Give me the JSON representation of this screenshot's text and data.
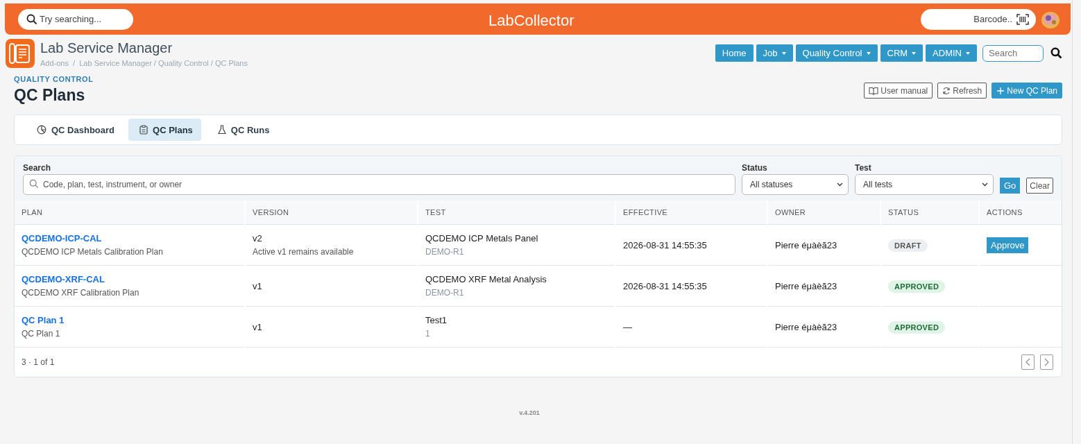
{
  "topbar": {
    "search_placeholder": "Try searching...",
    "logo": "LabCollector",
    "barcode_placeholder": "Barcode.."
  },
  "header": {
    "title": "Lab Service Manager",
    "breadcrumb": "Add-ons  /  Lab Service Manager / Quality Control / QC Plans"
  },
  "nav": [
    {
      "label": "Home",
      "dropdown": false
    },
    {
      "label": "Job",
      "dropdown": true
    },
    {
      "label": "Quality Control",
      "dropdown": true
    },
    {
      "label": "CRM",
      "dropdown": true
    },
    {
      "label": "ADMIN",
      "dropdown": true
    }
  ],
  "nav_search": {
    "placeholder": "Search"
  },
  "page": {
    "eyebrow": "QUALITY CONTROL",
    "title": "QC Plans",
    "actions": [
      {
        "label": "User manual",
        "kind": "manual"
      },
      {
        "label": "Refresh",
        "kind": "refresh"
      },
      {
        "label": "New QC Plan",
        "kind": "new"
      }
    ]
  },
  "tabs": [
    {
      "label": "QC Dashboard",
      "selected": false
    },
    {
      "label": "QC Plans",
      "selected": true
    },
    {
      "label": "QC Runs",
      "selected": false
    }
  ],
  "filters": {
    "search_label": "Search",
    "search_placeholder": "Code, plan, test, instrument, or owner",
    "status_label": "Status",
    "status_value": "All statuses",
    "test_label": "Test",
    "test_value": "All tests",
    "go": "Go",
    "clear": "Clear"
  },
  "table": {
    "columns": [
      "PLAN",
      "VERSION",
      "TEST",
      "EFFECTIVE",
      "OWNER",
      "STATUS",
      "ACTIONS"
    ],
    "rows": [
      {
        "code": "QCDEMO-ICP-CAL",
        "name": "QCDEMO ICP Metals Calibration Plan",
        "version": "v2",
        "version_note": "Active v1 remains available",
        "test": "QCDEMO ICP Metals Panel",
        "test_code": "DEMO-R1",
        "effective": "2026-08-31 14:55:35",
        "owner": "Pierre éμàèã23",
        "status": {
          "text": "DRAFT",
          "kind": "draft"
        },
        "action": "Approve"
      },
      {
        "code": "QCDEMO-XRF-CAL",
        "name": "QCDEMO XRF Calibration Plan",
        "version": "v1",
        "test": "QCDEMO XRF Metal Analysis",
        "test_code": "DEMO-R1",
        "effective": "2026-08-31 14:55:35",
        "owner": "Pierre éμàèã23",
        "status": {
          "text": "APPROVED",
          "kind": "approved"
        }
      },
      {
        "code": "QC Plan 1",
        "name": "QC Plan 1",
        "version": "v1",
        "test": "Test1",
        "test_code": "1",
        "effective": "—",
        "owner": "Pierre éμàèã23",
        "status": {
          "text": "APPROVED",
          "kind": "approved"
        }
      }
    ],
    "footer": "3 · 1 of 1"
  },
  "version": "v.4.201"
}
